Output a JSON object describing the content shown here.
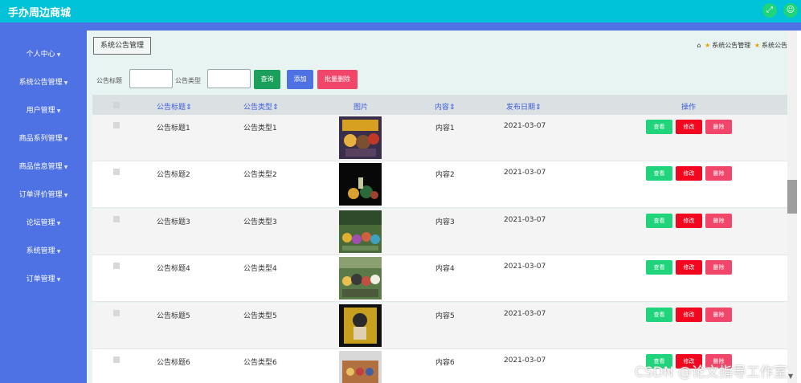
{
  "app": {
    "title": "手办周边商城"
  },
  "top_icons": [
    "fullscreen-icon",
    "user-icon"
  ],
  "sidebar": {
    "items": [
      {
        "label": "个人中心"
      },
      {
        "label": "系统公告管理"
      },
      {
        "label": "用户管理"
      },
      {
        "label": "商品系列管理"
      },
      {
        "label": "商品信息管理"
      },
      {
        "label": "订单评价管理"
      },
      {
        "label": "论坛管理"
      },
      {
        "label": "系统管理"
      },
      {
        "label": "订单管理"
      }
    ]
  },
  "header": {
    "section_title": "系统公告管理",
    "breadcrumb": [
      "系统公告管理",
      "系统公告列表"
    ]
  },
  "search": {
    "title_label": "公告标题",
    "title_value": "",
    "type_label": "公告类型",
    "type_value": "",
    "query_label": "查询",
    "add_label": "添加",
    "batch_delete_label": "批量删除"
  },
  "table": {
    "columns": [
      "公告标题",
      "公告类型",
      "图片",
      "内容",
      "发布日期",
      "操作"
    ],
    "sort_icon": "⇕",
    "actions": {
      "view": "查看",
      "edit": "修改",
      "delete": "删除"
    },
    "rows": [
      {
        "title": "公告标题1",
        "type": "公告类型1",
        "content": "内容1",
        "date": "2021-03-07"
      },
      {
        "title": "公告标题2",
        "type": "公告类型2",
        "content": "内容2",
        "date": "2021-03-07"
      },
      {
        "title": "公告标题3",
        "type": "公告类型3",
        "content": "内容3",
        "date": "2021-03-07"
      },
      {
        "title": "公告标题4",
        "type": "公告类型4",
        "content": "内容4",
        "date": "2021-03-07"
      },
      {
        "title": "公告标题5",
        "type": "公告类型5",
        "content": "内容5",
        "date": "2021-03-07"
      },
      {
        "title": "公告标题6",
        "type": "公告类型6",
        "content": "内容6",
        "date": "2021-03-07"
      }
    ]
  },
  "watermark": "CSDN @论文指导工作室",
  "colors": {
    "topbar": "#00c2d8",
    "sidebar": "#4e72e4",
    "view": "#1fd47a",
    "edit": "#f2071f",
    "delete": "#f2456a",
    "query": "#1aa05a",
    "add": "#4e72e4",
    "batch_delete": "#f2456a"
  }
}
